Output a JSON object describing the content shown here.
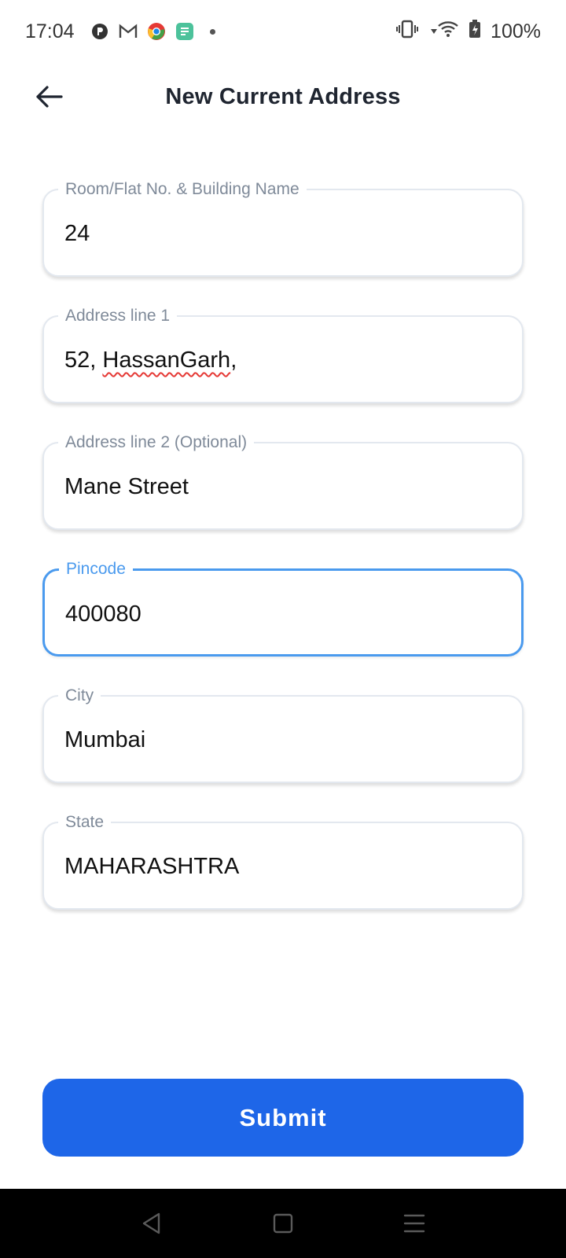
{
  "status_bar": {
    "time": "17:04",
    "battery": "100%",
    "notification_icons": [
      "p-icon",
      "gmail-icon",
      "chrome-icon",
      "app-icon"
    ]
  },
  "header": {
    "title": "New Current Address"
  },
  "form": {
    "room": {
      "label": "Room/Flat No. & Building Name",
      "value": "24"
    },
    "address1": {
      "label": "Address line 1",
      "value_prefix": "52, ",
      "value_misspelled": "HassanGarh",
      "value_suffix": ","
    },
    "address2": {
      "label": "Address line 2 (Optional)",
      "value": "Mane Street"
    },
    "pincode": {
      "label": "Pincode",
      "value": "400080"
    },
    "city": {
      "label": "City",
      "value": "Mumbai"
    },
    "state": {
      "label": "State",
      "value": "MAHARASHTRA"
    }
  },
  "submit_label": "Submit",
  "colors": {
    "primary": "#1e66e8",
    "focus_border": "#4a9aee",
    "label": "#7f8a99"
  }
}
